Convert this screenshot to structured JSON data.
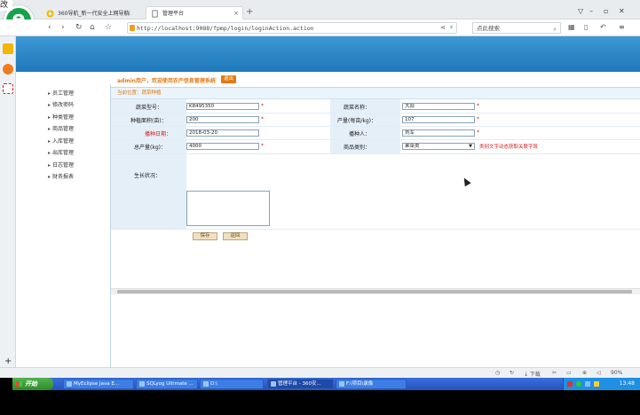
{
  "browser": {
    "tabs": [
      {
        "label": "360导航_新一代安全上网导航"
      },
      {
        "label": "管理平台"
      }
    ],
    "url": "http://localhost:9088/fpmp/login/loginAction.action",
    "search_placeholder": "点此搜索"
  },
  "page": {
    "welcome": "admin用户，欢迎使用农产信息管理系统",
    "logout_label": "退出",
    "breadcrumb": "当前位置：蔬菜种植"
  },
  "menu": [
    "员工管理",
    "修改密码",
    "种类管理",
    "商品管理",
    "入库管理",
    "出库管理",
    "日志管理",
    "财务报表"
  ],
  "form": {
    "fields": [
      {
        "label": "蔬菜型号：",
        "value": "K8495350"
      },
      {
        "label": "蔬菜名称：",
        "value": "大蒜"
      },
      {
        "label": "种植面积(亩)：",
        "value": "200"
      },
      {
        "label": "产量(每亩/kg)：",
        "value": "107"
      },
      {
        "label": "播种日期：",
        "value": "2018-03-20"
      },
      {
        "label": "播种人：",
        "value": "刘军"
      },
      {
        "label": "总产量(kg)：",
        "value": "4000"
      },
      {
        "label": "商品类别：",
        "value": "果菜类"
      },
      {
        "label": "生长状况：",
        "value": ""
      }
    ],
    "category_hint": "类别文字动态获取关联字段",
    "save_label": "保存",
    "back_label": "返回"
  },
  "status": {
    "download_label": "↓ 下载",
    "zoom": "90%"
  },
  "taskbar": {
    "start_label": "开始",
    "items": [
      "MyEclipse Java E...",
      "SQLyog Ultimate ...",
      "D:\\",
      "管理平台 - 360安...",
      "F:\\项目\\录像"
    ],
    "clock": "13:48"
  },
  "colors": {
    "banner": "#2a86c8",
    "accent_orange": "#e07a14",
    "required_red": "#d02020",
    "taskbar_blue": "#2552c0"
  }
}
